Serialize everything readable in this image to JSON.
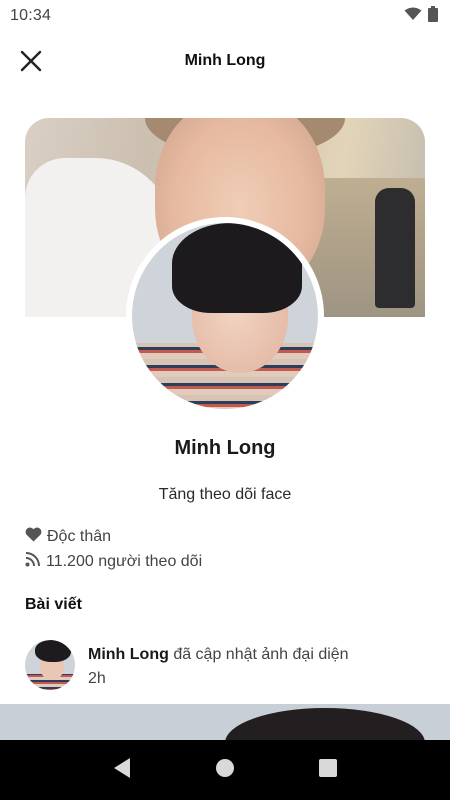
{
  "status_bar": {
    "time": "10:34",
    "icons": [
      "wifi-icon",
      "battery-icon"
    ]
  },
  "header": {
    "title": "Minh Long",
    "close_icon": "close-icon"
  },
  "profile": {
    "name": "Minh Long",
    "bio": "Tăng theo dõi face",
    "relationship": "Độc thân",
    "followers": "11.200 người theo dõi"
  },
  "posts_section": {
    "title": "Bài viết",
    "items": [
      {
        "author": "Minh Long",
        "action": "đã cập nhật ảnh đại diện",
        "time": "2h"
      }
    ]
  },
  "nav_bar": {
    "icons": [
      "back-icon",
      "home-icon",
      "recents-icon"
    ]
  },
  "colors": {
    "background": "#ffffff",
    "text_primary": "#1a1a1a",
    "text_secondary": "#444444",
    "nav_bar": "#000000"
  }
}
